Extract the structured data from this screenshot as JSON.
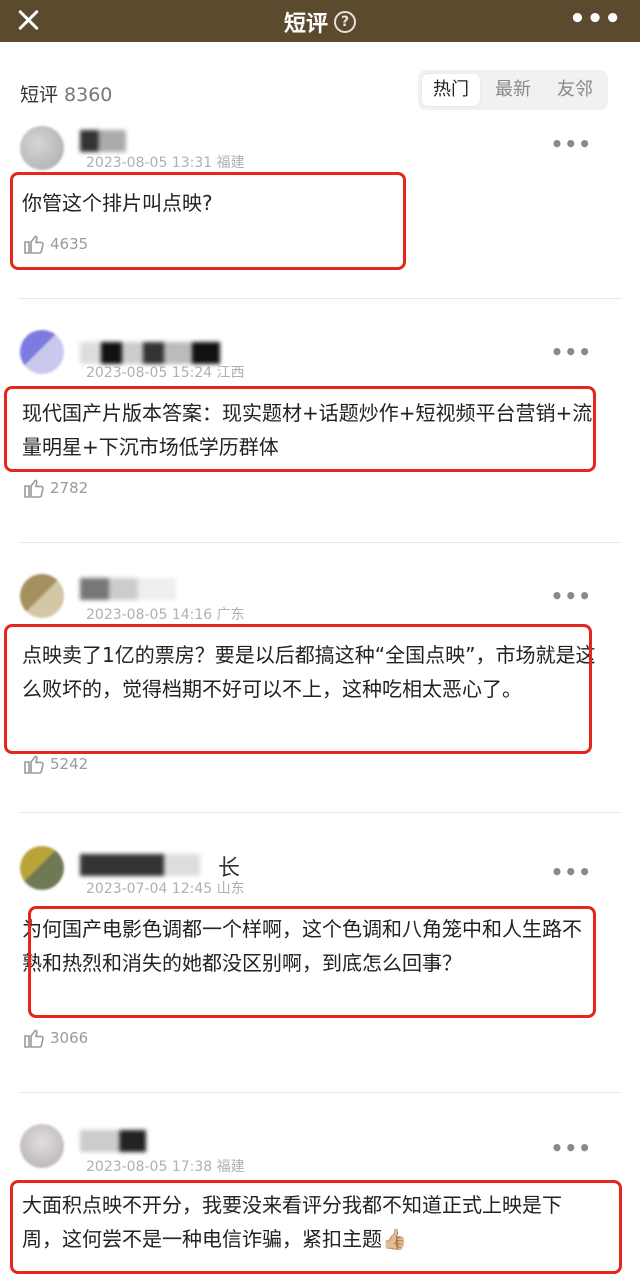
{
  "topbar": {
    "title": "短评",
    "help_icon": "?",
    "more_icon": "•••"
  },
  "subheader": {
    "title": "短评",
    "count": "8360",
    "tabs": [
      {
        "label": "热门",
        "active": true
      },
      {
        "label": "最新",
        "active": false
      },
      {
        "label": "友邻",
        "active": false
      }
    ]
  },
  "comments": [
    {
      "date": "2023-08-05 13:31",
      "location": "福建",
      "text": "你管这个排片叫点映?",
      "likes": "4635"
    },
    {
      "date": "2023-08-05 15:24",
      "location": "江西",
      "text": "现代国产片版本答案：现实题材+话题炒作+短视频平台营销+流量明星+下沉市场低学历群体",
      "likes": "2782"
    },
    {
      "date": "2023-08-05 14:16",
      "location": "广东",
      "text": "点映卖了1亿的票房？要是以后都搞这种“全国点映”，市场就是这么败坏的，觉得档期不好可以不上，这种吃相太恶心了。",
      "likes": "5242"
    },
    {
      "date": "2023-07-04 12:45",
      "location": "山东",
      "name_suffix": "长",
      "text": "为何国产电影色调都一个样啊，这个色调和八角笼中和人生路不熟和热烈和消失的她都没区别啊，到底怎么回事？",
      "likes": "3066"
    },
    {
      "date": "2023-08-05 17:38",
      "location": "福建",
      "text": "大面积点映不开分，我要没来看评分我都不知道正式上映是下周，这何尝不是一种电信诈骗，紧扣主题👍🏼",
      "likes": ""
    }
  ],
  "colors": {
    "topbar": "#5b4a2d",
    "highlight": "#e6251c"
  },
  "icons": [
    "close-icon",
    "help-icon",
    "more-icon",
    "thumbs-up-icon",
    "more-dots-icon"
  ]
}
